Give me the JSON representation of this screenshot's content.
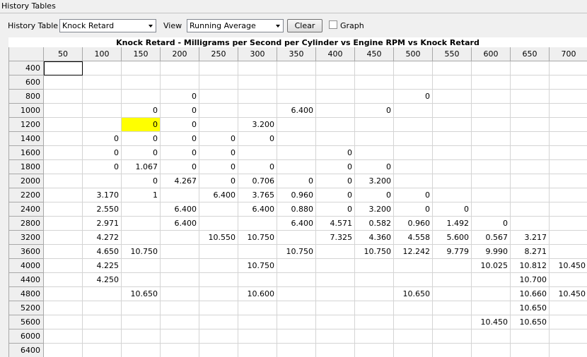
{
  "window": {
    "title": "History Tables"
  },
  "toolbar": {
    "history_table_label": "History Table",
    "history_table_value": "Knock Retard",
    "view_label": "View",
    "view_value": "Running Average",
    "clear_label": "Clear",
    "graph_label": "Graph",
    "graph_checked": false
  },
  "table": {
    "title": "Knock Retard - Milligrams per Second per Cylinder vs Engine RPM vs Knock Retard",
    "columns": [
      "50",
      "100",
      "150",
      "200",
      "250",
      "300",
      "350",
      "400",
      "450",
      "500",
      "550",
      "600",
      "650",
      "700"
    ],
    "rows": [
      {
        "label": "400",
        "cells": [
          "",
          "",
          "",
          "",
          "",
          "",
          "",
          "",
          "",
          "",
          "",
          "",
          "",
          ""
        ]
      },
      {
        "label": "600",
        "cells": [
          "",
          "",
          "",
          "",
          "",
          "",
          "",
          "",
          "",
          "",
          "",
          "",
          "",
          ""
        ]
      },
      {
        "label": "800",
        "cells": [
          "",
          "",
          "",
          "0",
          "",
          "",
          "",
          "",
          "",
          "0",
          "",
          "",
          "",
          ""
        ]
      },
      {
        "label": "1000",
        "cells": [
          "",
          "",
          "0",
          "0",
          "",
          "",
          "6.400",
          "",
          "0",
          "",
          "",
          "",
          "",
          ""
        ]
      },
      {
        "label": "1200",
        "cells": [
          "",
          "",
          "0",
          "0",
          "",
          "3.200",
          "",
          "",
          "",
          "",
          "",
          "",
          "",
          ""
        ]
      },
      {
        "label": "1400",
        "cells": [
          "",
          "0",
          "0",
          "0",
          "0",
          "0",
          "",
          "",
          "",
          "",
          "",
          "",
          "",
          ""
        ]
      },
      {
        "label": "1600",
        "cells": [
          "",
          "0",
          "0",
          "0",
          "0",
          "",
          "",
          "0",
          "",
          "",
          "",
          "",
          "",
          ""
        ]
      },
      {
        "label": "1800",
        "cells": [
          "",
          "0",
          "1.067",
          "0",
          "0",
          "0",
          "",
          "0",
          "0",
          "",
          "",
          "",
          "",
          ""
        ]
      },
      {
        "label": "2000",
        "cells": [
          "",
          "",
          "0",
          "4.267",
          "0",
          "0.706",
          "0",
          "0",
          "3.200",
          "",
          "",
          "",
          "",
          ""
        ]
      },
      {
        "label": "2200",
        "cells": [
          "",
          "3.170",
          "1",
          "",
          "6.400",
          "3.765",
          "0.960",
          "0",
          "0",
          "0",
          "",
          "",
          "",
          ""
        ]
      },
      {
        "label": "2400",
        "cells": [
          "",
          "2.550",
          "",
          "6.400",
          "",
          "6.400",
          "0.880",
          "0",
          "3.200",
          "0",
          "0",
          "",
          "",
          ""
        ]
      },
      {
        "label": "2800",
        "cells": [
          "",
          "2.971",
          "",
          "6.400",
          "",
          "",
          "6.400",
          "4.571",
          "0.582",
          "0.960",
          "1.492",
          "0",
          "",
          ""
        ]
      },
      {
        "label": "3200",
        "cells": [
          "",
          "4.272",
          "",
          "",
          "10.550",
          "10.750",
          "",
          "7.325",
          "4.360",
          "4.558",
          "5.600",
          "0.567",
          "3.217",
          ""
        ]
      },
      {
        "label": "3600",
        "cells": [
          "",
          "4.650",
          "10.750",
          "",
          "",
          "",
          "10.750",
          "",
          "10.750",
          "12.242",
          "9.779",
          "9.990",
          "8.271",
          ""
        ]
      },
      {
        "label": "4000",
        "cells": [
          "",
          "4.225",
          "",
          "",
          "",
          "10.750",
          "",
          "",
          "",
          "",
          "",
          "10.025",
          "10.812",
          "10.450"
        ]
      },
      {
        "label": "4400",
        "cells": [
          "",
          "4.250",
          "",
          "",
          "",
          "",
          "",
          "",
          "",
          "",
          "",
          "",
          "10.700",
          ""
        ]
      },
      {
        "label": "4800",
        "cells": [
          "",
          "",
          "10.650",
          "",
          "",
          "10.600",
          "",
          "",
          "",
          "10.650",
          "",
          "",
          "10.660",
          "10.450"
        ]
      },
      {
        "label": "5200",
        "cells": [
          "",
          "",
          "",
          "",
          "",
          "",
          "",
          "",
          "",
          "",
          "",
          "",
          "10.650",
          ""
        ]
      },
      {
        "label": "5600",
        "cells": [
          "",
          "",
          "",
          "",
          "",
          "",
          "",
          "",
          "",
          "",
          "",
          "10.450",
          "10.650",
          ""
        ]
      },
      {
        "label": "6000",
        "cells": [
          "",
          "",
          "",
          "",
          "",
          "",
          "",
          "",
          "",
          "",
          "",
          "",
          "",
          ""
        ]
      },
      {
        "label": "6400",
        "cells": [
          "",
          "",
          "",
          "",
          "",
          "",
          "",
          "",
          "",
          "",
          "",
          "",
          "",
          ""
        ]
      }
    ],
    "highlight": {
      "row": 4,
      "col": 2,
      "color": "#ffff00"
    },
    "focused": {
      "row": 0,
      "col": 0
    }
  }
}
